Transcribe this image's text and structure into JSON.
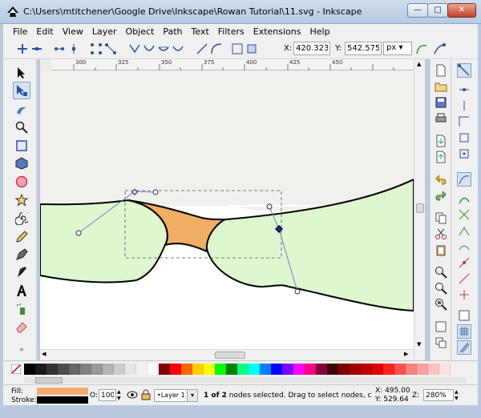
{
  "window": {
    "title": "C:\\Users\\mtitchener\\Google Drive\\Inkscape\\Rowan Tutorial\\11.svg - Inkscape",
    "min_glyph": "—",
    "max_glyph": "□",
    "close_glyph": "✕"
  },
  "menu": [
    {
      "label": "File"
    },
    {
      "label": "Edit"
    },
    {
      "label": "View"
    },
    {
      "label": "Layer"
    },
    {
      "label": "Object"
    },
    {
      "label": "Path"
    },
    {
      "label": "Text"
    },
    {
      "label": "Filters"
    },
    {
      "label": "Extensions"
    },
    {
      "label": "Help"
    }
  ],
  "node_toolbar": {
    "x_label": "X:",
    "x_value": "420.323",
    "y_label": "Y:",
    "y_value": "542.575",
    "unit": "px"
  },
  "ruler": {
    "ticks": [
      "300",
      "325",
      "350",
      "375",
      "400",
      "425",
      "450"
    ]
  },
  "status": {
    "fill_label": "Fill:",
    "stroke_label": "Stroke:",
    "opacity_label": "O:",
    "opacity_value": "100",
    "layer_name": "•Layer 1",
    "message_bold": "1 of 2",
    "message_rest": " nodes selected. Drag to select nodes, click to e",
    "x_label": "X:",
    "x_value": "495.00",
    "y_label": "Y:",
    "y_value": "529.64",
    "zoom_label": "Z:",
    "zoom_value": "280%"
  },
  "colors": {
    "fill": "#f2ad6e",
    "stroke": "#000000",
    "shape_green": "#ddf7cf",
    "shape_orange": "#f0ad63",
    "accent": "#2b50a3"
  },
  "palette": [
    "#000000",
    "#1a1a1a",
    "#333333",
    "#4d4d4d",
    "#666666",
    "#808080",
    "#999999",
    "#b3b3b3",
    "#cccccc",
    "#e6e6e6",
    "#f2f2f2",
    "#ffffff",
    "#800000",
    "#ff0000",
    "#ff6600",
    "#ffcc00",
    "#ffff00",
    "#00ff00",
    "#008000",
    "#00ff80",
    "#00ffff",
    "#0080ff",
    "#0000ff",
    "#8000ff",
    "#ff00ff",
    "#ff0080",
    "#800040",
    "#400000",
    "#800000",
    "#a00000",
    "#c00000",
    "#e00000",
    "#ff2020",
    "#ff5050",
    "#ff8080",
    "#ffa0a0",
    "#ffc0c0",
    "#ffe0e0"
  ]
}
